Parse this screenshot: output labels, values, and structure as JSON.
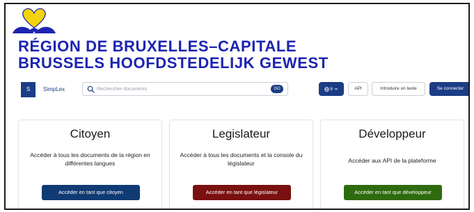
{
  "branding": {
    "title_fr": "RÉGION DE BRUXELLES–CAPITALE",
    "title_nl": "BRUSSELS HOOFDSTEDELIJK GEWEST",
    "logo_icon": "brussels-iris-heart-icon",
    "logo_colors": {
      "yellow": "#f3d40c",
      "blue": "#1c24b0"
    }
  },
  "header": {
    "brand_initial": "S",
    "brand_name": "SimpLex",
    "search_placeholder": "Rechercher documents",
    "search_icon": "search-icon",
    "go_label": "GO",
    "language": "fr",
    "globe_icon": "globe-icon",
    "api_label": "API",
    "introduce_text_label": "Introduire un texte",
    "login_label": "Se connecter"
  },
  "cards": [
    {
      "title": "Citoyen",
      "description": "Accéder à tous les documents de la région en différentes langues",
      "button_label": "Accéder en tant que citoyen",
      "button_color": "#103a73"
    },
    {
      "title": "Legislateur",
      "description": "Accéder à tous les documents et la console du législateur",
      "button_label": "Accéder en tant que législateur",
      "button_color": "#7a1010"
    },
    {
      "title": "Développeur",
      "description": "Accéder aux API de la plateforme",
      "button_label": "Accéder en tant que développeur",
      "button_color": "#2e6b0e"
    }
  ],
  "colors": {
    "primary": "#1b3d85",
    "title_blue": "#1c24b0"
  }
}
